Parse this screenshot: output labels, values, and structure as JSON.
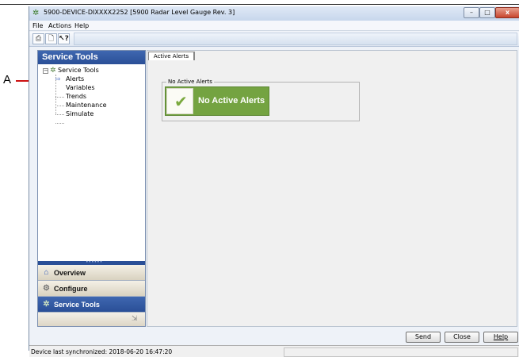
{
  "callout": {
    "letter": "A"
  },
  "window": {
    "title": "5900-DEVICE-DIXXXX2252 [5900 Radar Level Gauge Rev. 3]",
    "controls": {
      "minimize": "–",
      "maximize": "□",
      "close": "x"
    }
  },
  "menu": {
    "file": "File",
    "actions": "Actions",
    "help": "Help"
  },
  "toolbar": {
    "print_icon": "print-icon",
    "preview_icon": "print-preview-icon",
    "help_icon": "context-help-icon"
  },
  "left_pane": {
    "header": "Service Tools",
    "tree": {
      "root": "Service Tools",
      "items": [
        "Alerts",
        "Variables",
        "Trends",
        "Maintenance",
        "Simulate"
      ],
      "selected": "Alerts"
    },
    "nav": {
      "overview": "Overview",
      "configure": "Configure",
      "service_tools": "Service Tools",
      "active": "Service Tools"
    }
  },
  "main": {
    "tab": "Active Alerts",
    "group_label": "No Active Alerts",
    "alert_banner": "No Active Alerts",
    "status_color": "#74a341"
  },
  "buttons": {
    "send": "Send",
    "close": "Close",
    "help": "Help"
  },
  "status_bar": {
    "text": "Device last synchronized: 2018-06-20 16:47:20"
  }
}
